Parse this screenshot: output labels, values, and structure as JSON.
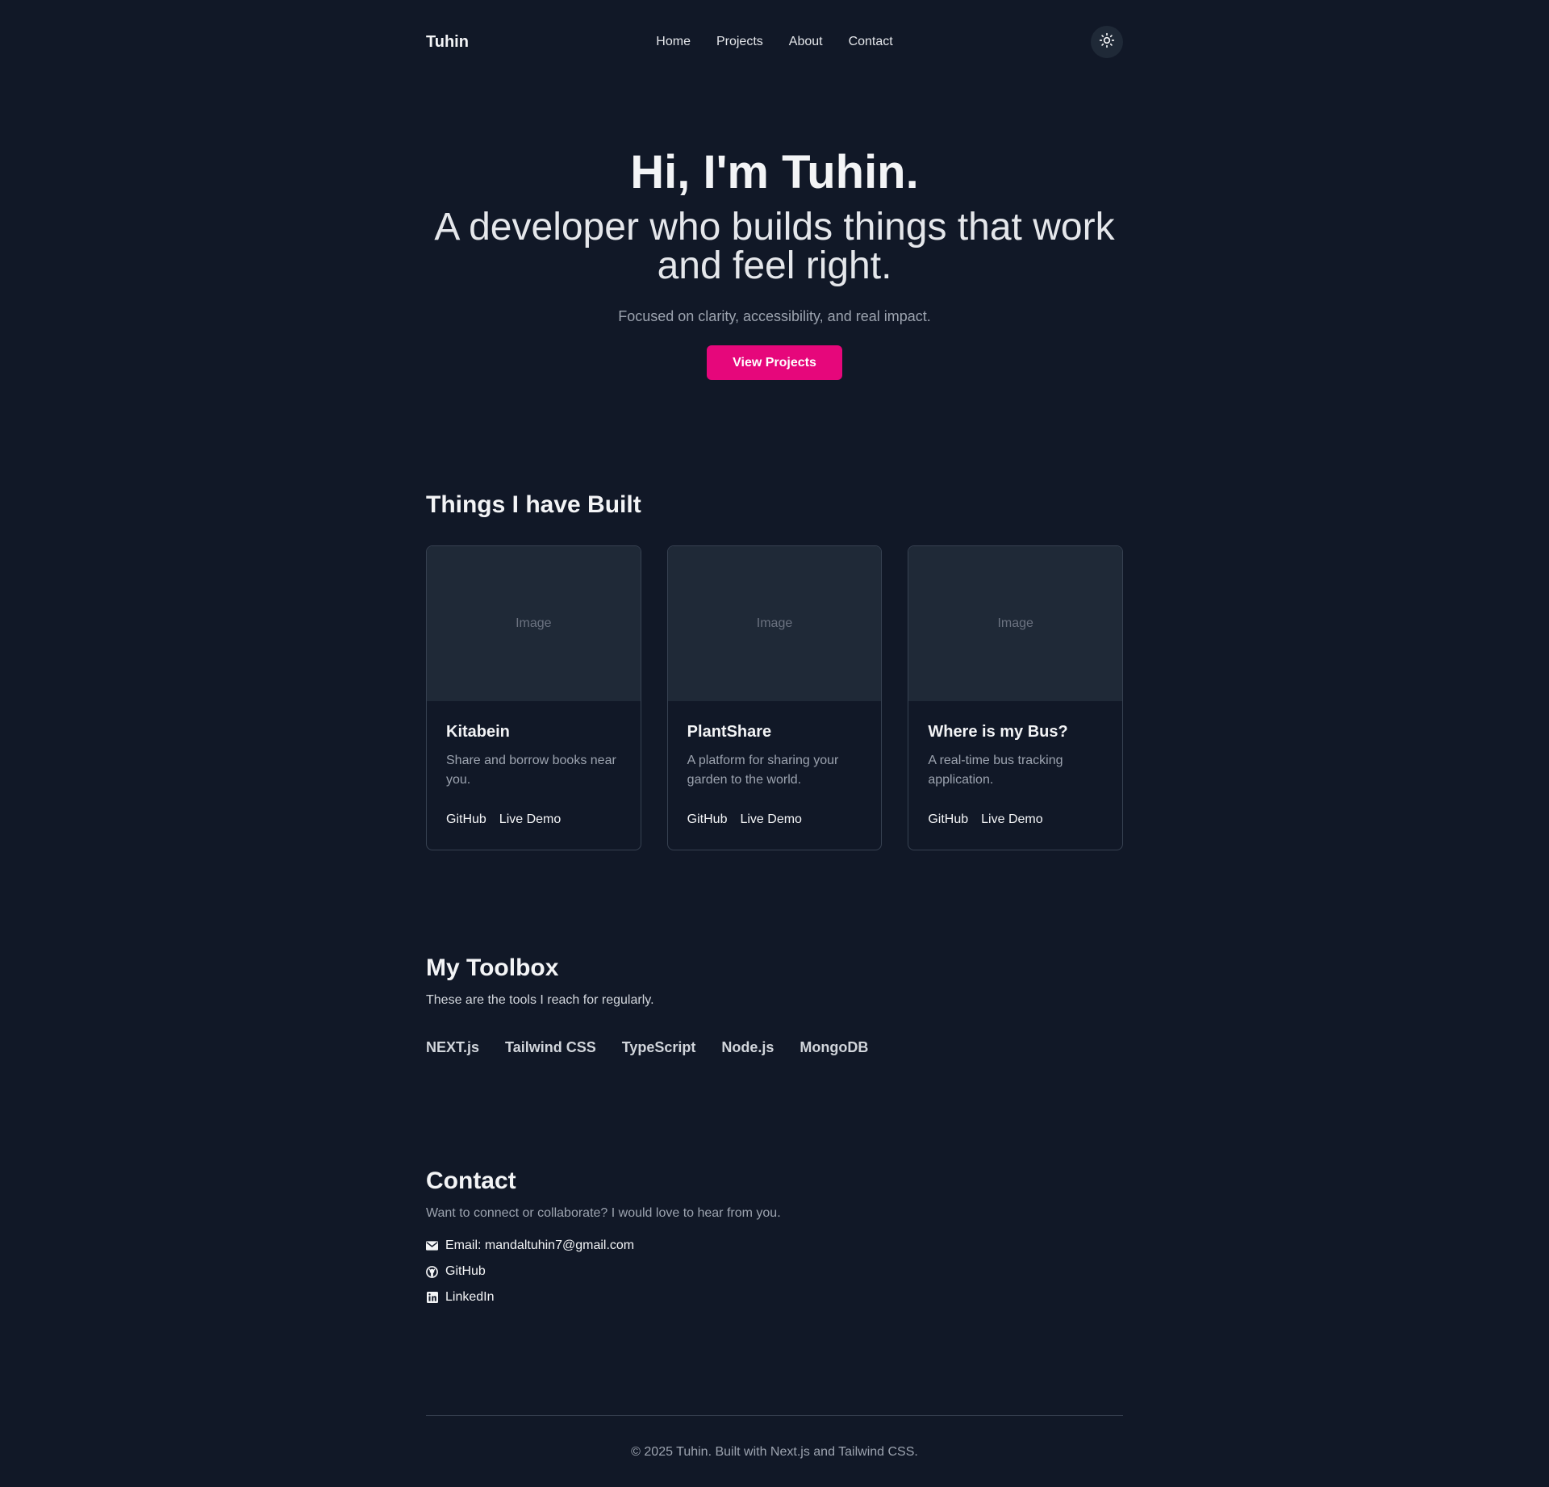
{
  "header": {
    "brand": "Tuhin",
    "nav": [
      "Home",
      "Projects",
      "About",
      "Contact"
    ],
    "theme_icon": "sun-icon"
  },
  "hero": {
    "title": "Hi, I'm Tuhin.",
    "subtitle": "A developer who builds things that work and feel right.",
    "tagline": "Focused on clarity, accessibility, and real impact.",
    "cta": "View Projects"
  },
  "projects": {
    "heading": "Things I have Built",
    "items": [
      {
        "image_label": "Image",
        "title": "Kitabein",
        "description": "Share and borrow books near you.",
        "github": "GitHub",
        "demo": "Live Demo"
      },
      {
        "image_label": "Image",
        "title": "PlantShare",
        "description": "A platform for sharing your garden to the world.",
        "github": "GitHub",
        "demo": "Live Demo"
      },
      {
        "image_label": "Image",
        "title": "Where is my Bus?",
        "description": "A real-time bus tracking application.",
        "github": "GitHub",
        "demo": "Live Demo"
      }
    ]
  },
  "toolbox": {
    "heading": "My Toolbox",
    "description": "These are the tools I reach for regularly.",
    "tools": [
      "NEXT.js",
      "Tailwind CSS",
      "TypeScript",
      "Node.js",
      "MongoDB"
    ]
  },
  "contact": {
    "heading": "Contact",
    "description": "Want to connect or collaborate? I would love to hear from you.",
    "links": [
      {
        "icon": "envelope-icon",
        "label": "Email: mandaltuhin7@gmail.com"
      },
      {
        "icon": "github-icon",
        "label": "GitHub"
      },
      {
        "icon": "linkedin-icon",
        "label": "LinkedIn"
      }
    ]
  },
  "footer": {
    "text": "© 2025 Tuhin. Built with Next.js and Tailwind CSS."
  },
  "colors": {
    "background": "#111827",
    "accent": "#e6077b",
    "card_image_bg": "#1f2937",
    "border": "#374151"
  }
}
